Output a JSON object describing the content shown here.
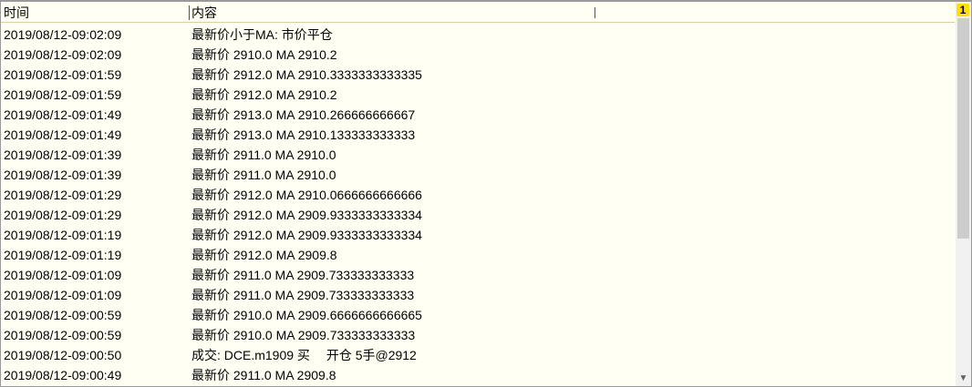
{
  "header": {
    "time_label": "时间",
    "content_label": "内容"
  },
  "badge": "1",
  "rows": [
    {
      "time": "2019/08/12-09:02:09",
      "content": "最新价小于MA: 市价平仓"
    },
    {
      "time": "2019/08/12-09:02:09",
      "content": "最新价 2910.0 MA 2910.2"
    },
    {
      "time": "2019/08/12-09:01:59",
      "content": "最新价 2912.0 MA 2910.3333333333335"
    },
    {
      "time": "2019/08/12-09:01:59",
      "content": "最新价 2912.0 MA 2910.2"
    },
    {
      "time": "2019/08/12-09:01:49",
      "content": "最新价 2913.0 MA 2910.266666666667"
    },
    {
      "time": "2019/08/12-09:01:49",
      "content": "最新价 2913.0 MA 2910.133333333333"
    },
    {
      "time": "2019/08/12-09:01:39",
      "content": "最新价 2911.0 MA 2910.0"
    },
    {
      "time": "2019/08/12-09:01:39",
      "content": "最新价 2911.0 MA 2910.0"
    },
    {
      "time": "2019/08/12-09:01:29",
      "content": "最新价 2912.0 MA 2910.0666666666666"
    },
    {
      "time": "2019/08/12-09:01:29",
      "content": "最新价 2912.0 MA 2909.9333333333334"
    },
    {
      "time": "2019/08/12-09:01:19",
      "content": "最新价 2912.0 MA 2909.9333333333334"
    },
    {
      "time": "2019/08/12-09:01:19",
      "content": "最新价 2912.0 MA 2909.8"
    },
    {
      "time": "2019/08/12-09:01:09",
      "content": "最新价 2911.0 MA 2909.733333333333"
    },
    {
      "time": "2019/08/12-09:01:09",
      "content": "最新价 2911.0 MA 2909.733333333333"
    },
    {
      "time": "2019/08/12-09:00:59",
      "content": "最新价 2910.0 MA 2909.6666666666665"
    },
    {
      "time": "2019/08/12-09:00:59",
      "content": "最新价 2910.0 MA 2909.733333333333"
    },
    {
      "time": "2019/08/12-09:00:50",
      "content": "成交: DCE.m1909 买 　开仓 5手@2912"
    },
    {
      "time": "2019/08/12-09:00:49",
      "content": "最新价 2911.0 MA 2909.8"
    }
  ]
}
